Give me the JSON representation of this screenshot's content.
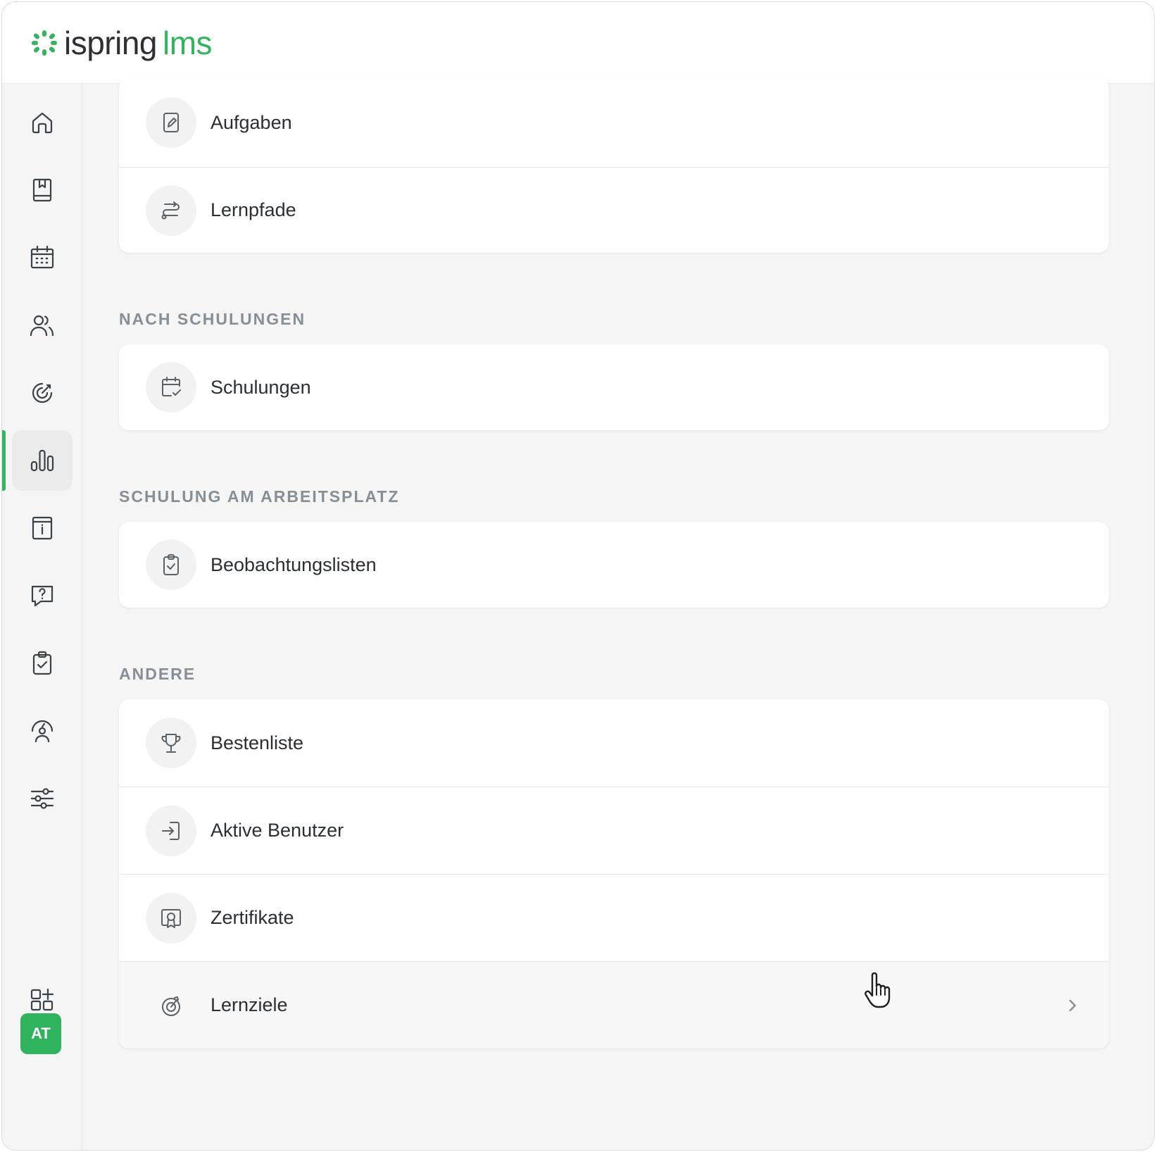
{
  "logo": {
    "part1": "ispring",
    "part2": "lms",
    "brand_color": "#35b45f"
  },
  "sidebar": {
    "items": [
      {
        "icon": "home-icon"
      },
      {
        "icon": "book-icon"
      },
      {
        "icon": "calendar-icon"
      },
      {
        "icon": "users-icon"
      },
      {
        "icon": "target-icon"
      },
      {
        "icon": "bar-chart-icon",
        "active": true
      },
      {
        "icon": "info-card-icon"
      },
      {
        "icon": "question-chat-icon"
      },
      {
        "icon": "clipboard-check-icon"
      },
      {
        "icon": "user-gauge-icon"
      },
      {
        "icon": "sliders-icon"
      },
      {
        "icon": "apps-add-icon"
      }
    ],
    "avatar_initials": "AT"
  },
  "sections": [
    {
      "title": "",
      "items": [
        {
          "label": "Aufgaben",
          "icon": "edit-document-icon"
        },
        {
          "label": "Lernpfade",
          "icon": "route-icon"
        }
      ]
    },
    {
      "title": "NACH SCHULUNGEN",
      "items": [
        {
          "label": "Schulungen",
          "icon": "calendar-check-icon"
        }
      ]
    },
    {
      "title": "SCHULUNG AM ARBEITSPLATZ",
      "items": [
        {
          "label": "Beobachtungslisten",
          "icon": "clipboard-check-icon"
        }
      ]
    },
    {
      "title": "ANDERE",
      "items": [
        {
          "label": "Bestenliste",
          "icon": "trophy-icon"
        },
        {
          "label": "Aktive Benutzer",
          "icon": "login-icon"
        },
        {
          "label": "Zertifikate",
          "icon": "certificate-icon"
        },
        {
          "label": "Lernziele",
          "icon": "goal-icon",
          "hovered": true
        }
      ]
    }
  ]
}
